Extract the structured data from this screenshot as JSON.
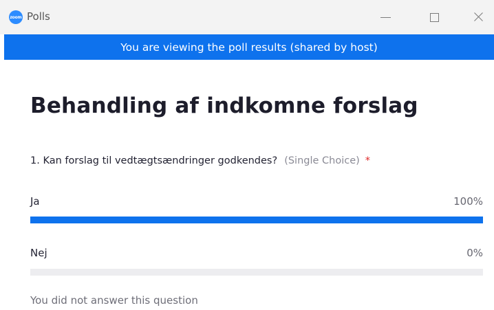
{
  "window": {
    "title": "Polls",
    "logo_text": "zoom"
  },
  "banner": {
    "text": "You are viewing the poll results (shared by host)"
  },
  "poll": {
    "title": "Behandling af indkomne forslag",
    "question": {
      "text": "1. Kan forslag til vedtægtsændringer godkendes?",
      "type": "(Single Choice)",
      "required_marker": "*"
    },
    "options": [
      {
        "label": "Ja",
        "percent_label": "100%",
        "percent": 100
      },
      {
        "label": "Nej",
        "percent_label": "0%",
        "percent": 0
      }
    ],
    "footer_note": "You did not answer this question"
  },
  "colors": {
    "accent": "#0e72ed",
    "track": "#ededf0",
    "required": "#e02828"
  }
}
